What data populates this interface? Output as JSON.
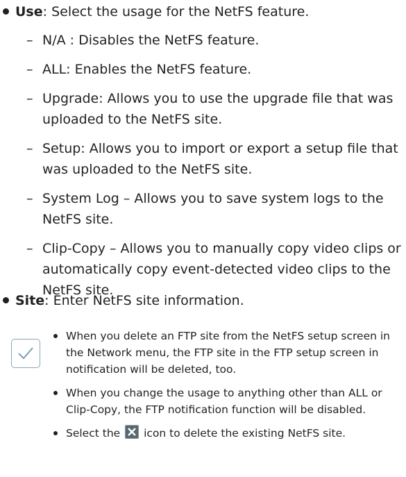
{
  "use": {
    "term": "Use",
    "desc": ": Select the usage for the NetFS feature.",
    "options": [
      "N/A : Disables the NetFS feature.",
      "ALL: Enables the NetFS feature.",
      "Upgrade: Allows you to use the upgrade file that was uploaded to the NetFS site.",
      "Setup: Allows you to import or export a setup file that was uploaded to the NetFS site.",
      "System Log – Allows you to save system logs to the NetFS site.",
      "Clip-Copy – Allows you to manually copy video clips or automatically copy event-detected video clips to the NetFS site."
    ]
  },
  "site": {
    "term": "Site",
    "desc": ": Enter NetFS site information."
  },
  "note": {
    "icon": "checkmark-icon",
    "items": [
      "When you delete an FTP site from the NetFS setup screen in the Network menu, the FTP site in the FTP setup screen in notification will be deleted, too.",
      "When you change the usage to anything other than ALL or Clip-Copy, the FTP notification function will be disabled."
    ],
    "last_before": "Select the",
    "last_after": "icon to delete the existing NetFS site.",
    "delete_icon": "delete-x-icon"
  },
  "dash": "–"
}
